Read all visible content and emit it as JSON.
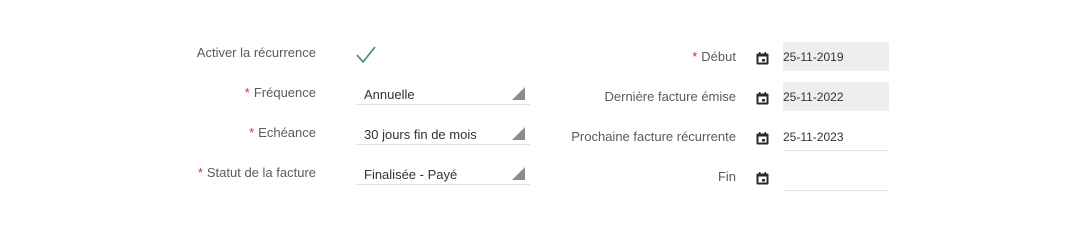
{
  "left": {
    "recurrence_label": "Activer la récurrence",
    "recurrence_checked": true,
    "frequency": {
      "required_mark": "*",
      "label": "Fréquence",
      "value": "Annuelle"
    },
    "due": {
      "required_mark": "*",
      "label": "Echéance",
      "value": "30 jours fin de mois"
    },
    "status": {
      "required_mark": "*",
      "label": "Statut de la facture",
      "value": "Finalisée - Payé"
    }
  },
  "right": {
    "start": {
      "required_mark": "*",
      "label": "Début",
      "value": "25-11-2019"
    },
    "last_invoice": {
      "label": "Dernière facture émise",
      "value": "25-11-2022"
    },
    "next_invoice": {
      "label": "Prochaine facture récurrente",
      "value": "25-11-2023"
    },
    "end": {
      "label": "Fin",
      "value": ""
    }
  },
  "icons": {
    "check": "checkmark-icon",
    "calendar": "calendar-icon",
    "dropdown": "dropdown-arrow-icon"
  },
  "colors": {
    "required": "#c0392b",
    "check": "#3a8a6e",
    "readonly_bg": "#eeeeee"
  }
}
